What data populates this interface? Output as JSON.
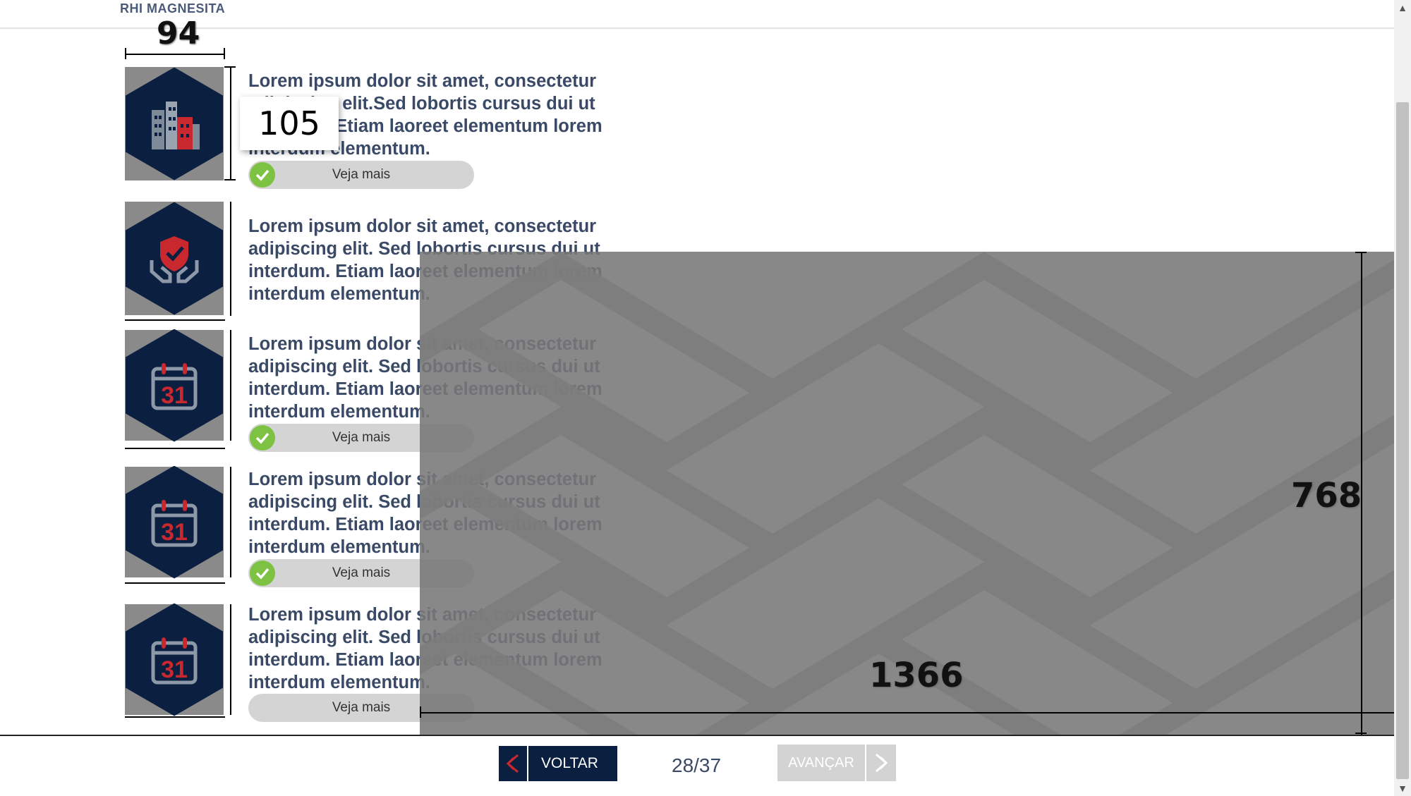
{
  "header": {
    "brand": "RHI MAGNESITA"
  },
  "items": [
    {
      "icon": "city-buildings-icon",
      "text": "Lorem ipsum dolor sit amet, consectetur adipiscing elit.Sed lobortis cursus dui ut interdum. Etiam laoreet elementum lorem interdum elementum.",
      "button": "Veja mais",
      "checked": true
    },
    {
      "icon": "shield-hands-icon",
      "text": "Lorem ipsum dolor sit amet, consectetur adipiscing elit. Sed lobortis cursus dui ut interdum. Etiam laoreet elementum lorem interdum elementum."
    },
    {
      "icon": "calendar-icon",
      "icon_text": "31",
      "text": "Lorem ipsum dolor sit amet, consectetur adipiscing elit. Sed lobortis cursus dui ut interdum. Etiam laoreet elementum lorem interdum elementum.",
      "button": "Veja mais",
      "checked": true
    },
    {
      "icon": "calendar-icon",
      "icon_text": "31",
      "text": "Lorem ipsum dolor sit amet, consectetur adipiscing elit. Sed lobortis cursus dui ut interdum. Etiam laoreet elementum lorem interdum elementum.",
      "button": "Veja mais",
      "checked": true
    },
    {
      "icon": "calendar-icon",
      "icon_text": "31",
      "text": "Lorem ipsum dolor sit amet, consectetur adipiscing elit. Sed lobortis cursus dui ut interdum. Etiam laoreet elementum lorem interdum elementum.",
      "button": "Veja mais",
      "checked": false
    }
  ],
  "dimensions": {
    "icon_width": "94",
    "icon_height": "105",
    "frame_width": "1366",
    "frame_height": "768"
  },
  "footer": {
    "back_label": "VOLTAR",
    "page": "28/37",
    "next_label": "AVANÇAR"
  },
  "colors": {
    "navy": "#0b1f40",
    "red": "#c8282e",
    "green": "#7dc242",
    "text": "#3a4a66"
  }
}
